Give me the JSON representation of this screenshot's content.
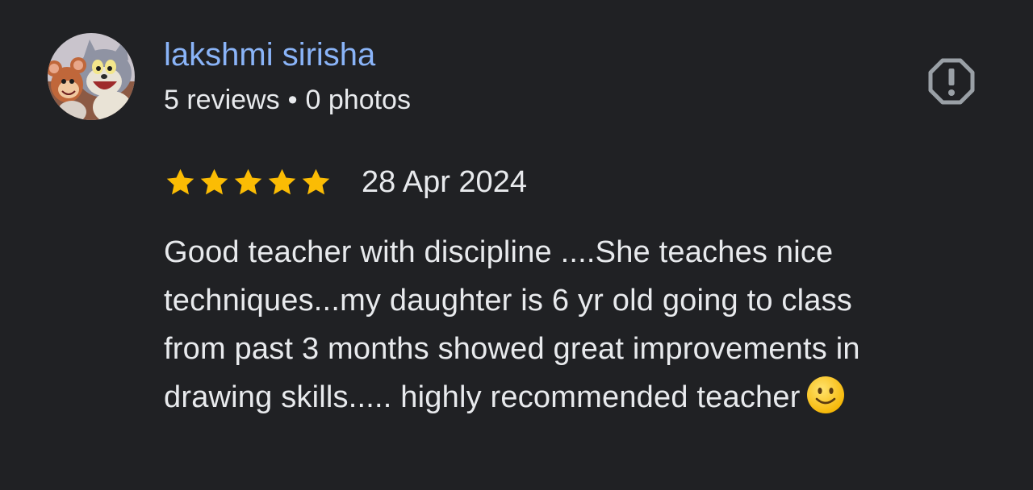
{
  "reviewer": {
    "name": "lakshmi sirisha",
    "reviews": "5 reviews",
    "separator": "•",
    "photos": "0 photos"
  },
  "rating": {
    "stars": 5,
    "max_stars": 5,
    "date": "28 Apr 2024"
  },
  "review": {
    "lines": [
      "Good teacher with discipline ....She teaches nice",
      "techniques...my daughter is 6 yr old going to class",
      "from past 3 months showed great improvements in",
      "drawing skills..... highly recommended teacher"
    ],
    "emoji_icon": "slightly-smiling-face-icon"
  },
  "icons": {
    "report": "report-flag-icon",
    "avatar": "cartoon-avatar-icon"
  },
  "colors": {
    "background": "#202124",
    "name": "#8ab4f8",
    "text": "#e8eaed",
    "star": "#fbbc04",
    "icon": "#9aa0a6"
  }
}
